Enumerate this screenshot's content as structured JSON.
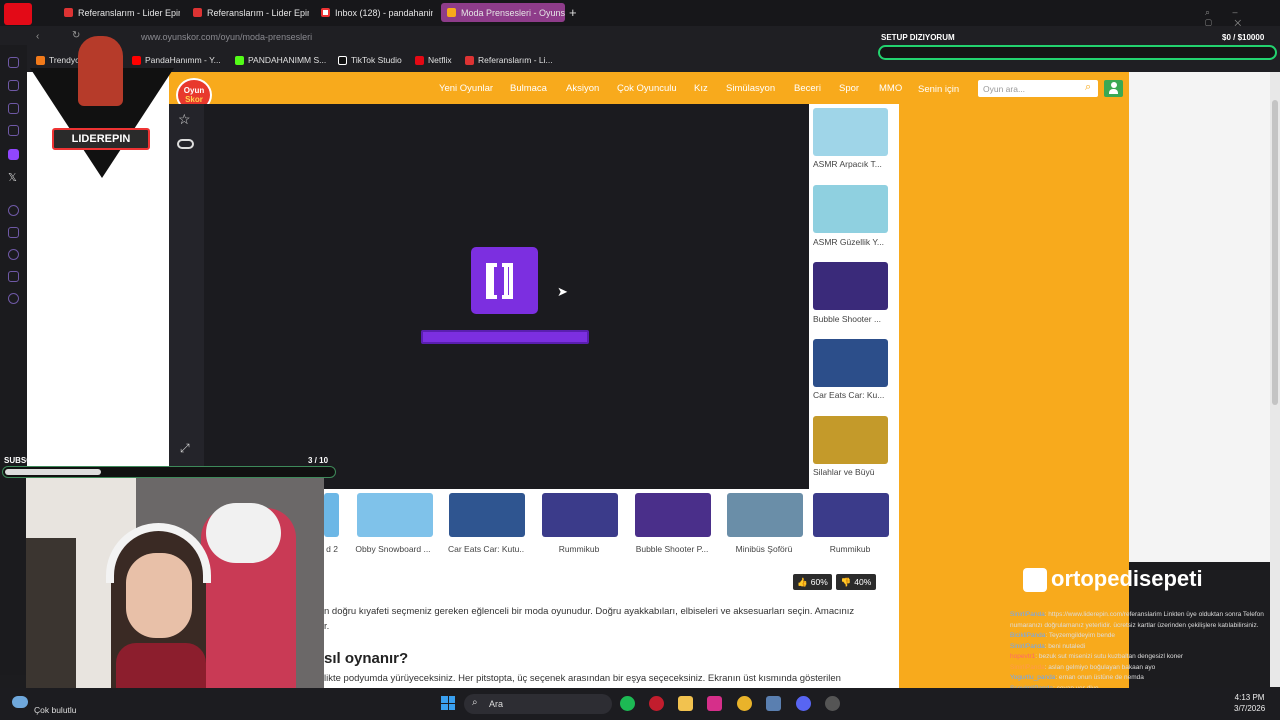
{
  "browser": {
    "tabs": [
      {
        "label": "Referanslarım - Lider Epin",
        "active": false
      },
      {
        "label": "Referanslarım - Lider Epin",
        "active": false
      },
      {
        "label": "Inbox (128) - pandahanim",
        "active": false
      },
      {
        "label": "Moda Prensesleri - Oyunsk",
        "active": true
      }
    ],
    "new_tab": "+",
    "url": "www.oyunskor.com/oyun/moda-prensesleri",
    "bookmarks": [
      "Trendyol",
      "PandaHanımm - Y...",
      "PANDAHANIMM S...",
      "TikTok Studio",
      "Netflix",
      "Referanslarım - Li..."
    ]
  },
  "site": {
    "logo_line1": "Oyun",
    "logo_line2": "Skor",
    "nav": [
      "Yeni Oyunlar",
      "Bulmaca",
      "Aksiyon",
      "Çok Oyunculu",
      "Kız",
      "Simülasyon",
      "Beceri",
      "Spor",
      "MMO",
      "Senin için"
    ],
    "search_placeholder": "Oyun ara...",
    "side_games": [
      {
        "label": "ASMR Arpacık T...",
        "color": "#9fd5e8"
      },
      {
        "label": "ASMR Güzellik Y...",
        "color": "#8fd0e0"
      },
      {
        "label": "Bubble Shooter ...",
        "color": "#3a2a7a"
      },
      {
        "label": "Car Eats Car: Ku...",
        "color": "#2c4e8a"
      },
      {
        "label": "Silahlar ve Büyü",
        "color": "#c49a2a"
      }
    ],
    "bottom_games": [
      {
        "label": "d 2",
        "color": "#6cb7e6"
      },
      {
        "label": "Obby Snowboard ...",
        "color": "#7fc2ea"
      },
      {
        "label": "Car Eats Car: Kutu...",
        "color": "#2f5590"
      },
      {
        "label": "Rummikub",
        "color": "#3b3b8a"
      },
      {
        "label": "Bubble Shooter P...",
        "color": "#4a2f8a"
      },
      {
        "label": "Minibüs Şoförü",
        "color": "#6a8ea8"
      },
      {
        "label": "Rummikub",
        "color": "#3b3b8a"
      }
    ],
    "votes": {
      "up": "60%",
      "down": "40%"
    },
    "description": "n doğru kıyafeti seçmeniz gereken eğlenceli bir moda oyunudur. Doğru ayakkabıları, elbiseleri ve aksesuarları seçin. Amacınız",
    "description_tail": "r.",
    "how_title": "sıl oynanır?",
    "how_text": "likte podyumda yürüyeceksiniz. Her pitstopta, üç seçenek arasından bir eşya seçeceksiniz. Ekranın üst kısmında gösterilen"
  },
  "overlay": {
    "subscribers_label": "SUBSCRIBERS",
    "subscribers_count": "3 / 10",
    "subscribers_progress": 0.3,
    "setup_label": "SETUP DIZIYORUM",
    "setup_amount": "$0 / $10000",
    "sponsor": "ortopedisepeti",
    "streamer_logo": "LIDEREPIN",
    "chat": [
      {
        "user": "SinirliPanda",
        "text": ": https://www.liderepin.com/referanslarim Linkten üye olduktan sonra Telefon numaranızı doğrulamanız yeterlidir. ücretsiz kartlar üzerinden çekilişlere katılabilirsiniz."
      },
      {
        "user": "BicikliPanda",
        "text": ": Teyzemgildeyim bende"
      },
      {
        "user": "SinirliPanda",
        "text": ": beni nutaledi"
      },
      {
        "user": "hopevtr1",
        "text": ": bezuk sut misenizi sutu kuzbaltan dengesizl koner"
      },
      {
        "user": "SinirliPanda",
        "text": ": aslan gelmiyo boğulayan bakaan ayo"
      },
      {
        "user": "Yogurtlu_panda",
        "text": ": ernan onun üstüne de nemda"
      },
      {
        "user": "SsevimliPanda",
        "text": ": cevap ver diyo"
      }
    ]
  },
  "taskbar": {
    "search_label": "Ara",
    "weather": "Çok bulutlu",
    "time": "4:13 PM",
    "date": "3/7/2026"
  }
}
